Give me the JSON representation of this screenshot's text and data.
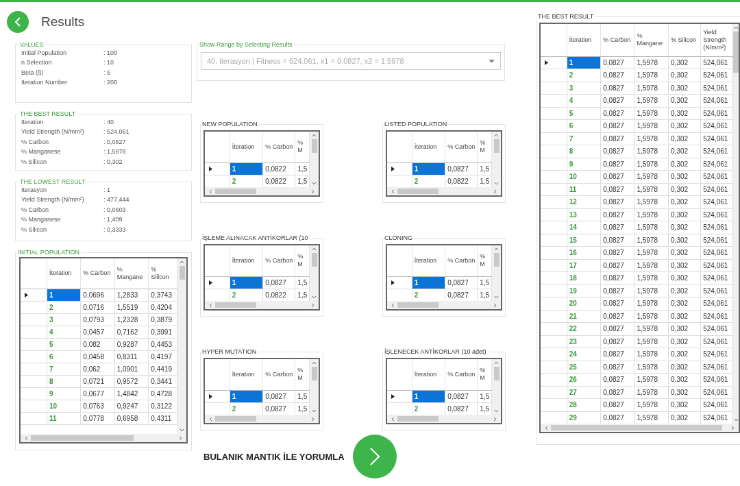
{
  "header": {
    "title": "Results"
  },
  "info_panels": [
    {
      "title": "VALUES",
      "rows": [
        {
          "label": "Initial Population",
          "value": ": 100"
        },
        {
          "label": "n Selection",
          "value": ": 10"
        },
        {
          "label": "Beta (ß)",
          "value": ": 5"
        },
        {
          "label": "Iteration Number",
          "value": ": 200"
        }
      ]
    },
    {
      "title": "THE BEST RESULT",
      "rows": [
        {
          "label": "Iteration",
          "value": ": 40"
        },
        {
          "label": "Yield Strength (N/mm²)",
          "value": ": 524,061"
        },
        {
          "label": "% Carbon",
          "value": ": 0,0827"
        },
        {
          "label": "% Manganese",
          "value": ": 1,5978"
        },
        {
          "label": "% Silicon",
          "value": ": 0,302"
        }
      ]
    },
    {
      "title": "THE LOWEST RESULT",
      "rows": [
        {
          "label": "İterasyon",
          "value": ": 1"
        },
        {
          "label": "Yield Strength (N/mm²)",
          "value": ": 477,444"
        },
        {
          "label": "% Carbon",
          "value": ": 0,0603"
        },
        {
          "label": "% Manganese",
          "value": ": 1,409"
        },
        {
          "label": "% Silicon",
          "value": ": 0,3333"
        }
      ]
    }
  ],
  "initial_population": {
    "title": "INITIAL POPULATION",
    "columns": [
      "İteration",
      "% Carbon",
      "% Mangane",
      "% Silicon"
    ],
    "rows": [
      {
        "cells": [
          "1",
          "0,0696",
          "1,2833",
          "0,3743"
        ],
        "selected": true
      },
      {
        "cells": [
          "2",
          "0,0716",
          "1,5519",
          "0,4204"
        ],
        "selected": false
      },
      {
        "cells": [
          "3",
          "0,0793",
          "1,2328",
          "0,3879"
        ],
        "selected": false
      },
      {
        "cells": [
          "4",
          "0,0457",
          "0,7162",
          "0,3991"
        ],
        "selected": false
      },
      {
        "cells": [
          "5",
          "0,082",
          "0,9287",
          "0,4453"
        ],
        "selected": false
      },
      {
        "cells": [
          "6",
          "0,0458",
          "0,8311",
          "0,4197"
        ],
        "selected": false
      },
      {
        "cells": [
          "7",
          "0,062",
          "1,0901",
          "0,4419"
        ],
        "selected": false
      },
      {
        "cells": [
          "8",
          "0,0721",
          "0,9572",
          "0,3441"
        ],
        "selected": false
      },
      {
        "cells": [
          "9",
          "0,0677",
          "1,4842",
          "0,4728"
        ],
        "selected": false
      },
      {
        "cells": [
          "10",
          "0,0763",
          "0,9247",
          "0,3122"
        ],
        "selected": false
      },
      {
        "cells": [
          "11",
          "0,0778",
          "0,6958",
          "0,4311"
        ],
        "selected": false
      }
    ]
  },
  "range": {
    "title": "Show Range by Selecting Results",
    "value": "40. iterasyon | Fitness = 524.061, x1 = 0.0827, x2 = 1.5978"
  },
  "grids": [
    {
      "title": "NEW POPULATION",
      "columns": [
        "İteration",
        "% Carbon",
        "% M"
      ],
      "rows": [
        {
          "cells": [
            "1",
            "0,0822",
            "1,5"
          ],
          "selected": true
        },
        {
          "cells": [
            "2",
            "0,0822",
            "1,5"
          ],
          "selected": false
        }
      ]
    },
    {
      "title": "LISTED POPULATION",
      "columns": [
        "İteration",
        "% Carbon",
        "% M"
      ],
      "rows": [
        {
          "cells": [
            "1",
            "0,0827",
            "1,5"
          ],
          "selected": true
        },
        {
          "cells": [
            "2",
            "0,0822",
            "1,5"
          ],
          "selected": false
        }
      ]
    },
    {
      "title": "İŞLEME ALINACAK ANTİKORLAR (10",
      "columns": [
        "İteration",
        "% Carbon",
        "% M"
      ],
      "rows": [
        {
          "cells": [
            "1",
            "0,0827",
            "1,5"
          ],
          "selected": true
        },
        {
          "cells": [
            "2",
            "0,0822",
            "1,5"
          ],
          "selected": false
        }
      ]
    },
    {
      "title": "CLONING",
      "columns": [
        "İteration",
        "% Carbon",
        "% M"
      ],
      "rows": [
        {
          "cells": [
            "1",
            "0,0827",
            "1,5"
          ],
          "selected": true
        },
        {
          "cells": [
            "2",
            "0,0827",
            "1,5"
          ],
          "selected": false
        }
      ]
    },
    {
      "title": "HYPER MUTATION",
      "columns": [
        "İteration",
        "% Carbon",
        "% M"
      ],
      "rows": [
        {
          "cells": [
            "1",
            "0,0827",
            "1,5"
          ],
          "selected": true
        },
        {
          "cells": [
            "2",
            "0,0827",
            "1,5"
          ],
          "selected": false
        }
      ]
    },
    {
      "title": "İŞLENECEK ANTİKORLAR (10 adet)",
      "columns": [
        "İteration",
        "% Carbon",
        "% M"
      ],
      "rows": [
        {
          "cells": [
            "1",
            "0,0827",
            "1,5"
          ],
          "selected": true
        },
        {
          "cells": [
            "2",
            "0,0827",
            "1,5"
          ],
          "selected": false
        }
      ]
    }
  ],
  "action": {
    "label": "BULANIK MANTIK İLE YORUMLA"
  },
  "best_table": {
    "title": "THE BEST RESULT",
    "columns": [
      "İteration",
      "% Carbon",
      "% Mangane",
      "% Silicon",
      "Yield Strength (N/mm²)"
    ],
    "rows": [
      {
        "cells": [
          "1",
          "0,0827",
          "1,5978",
          "0,302",
          "524,061"
        ],
        "selected": true
      },
      {
        "cells": [
          "2",
          "0,0827",
          "1,5978",
          "0,302",
          "524,061"
        ],
        "selected": false
      },
      {
        "cells": [
          "3",
          "0,0827",
          "1,5978",
          "0,302",
          "524,061"
        ],
        "selected": false
      },
      {
        "cells": [
          "4",
          "0,0827",
          "1,5978",
          "0,302",
          "524,061"
        ],
        "selected": false
      },
      {
        "cells": [
          "5",
          "0,0827",
          "1,5978",
          "0,302",
          "524,061"
        ],
        "selected": false
      },
      {
        "cells": [
          "6",
          "0,0827",
          "1,5978",
          "0,302",
          "524,061"
        ],
        "selected": false
      },
      {
        "cells": [
          "7",
          "0,0827",
          "1,5978",
          "0,302",
          "524,061"
        ],
        "selected": false
      },
      {
        "cells": [
          "8",
          "0,0827",
          "1,5978",
          "0,302",
          "524,061"
        ],
        "selected": false
      },
      {
        "cells": [
          "9",
          "0,0827",
          "1,5978",
          "0,302",
          "524,061"
        ],
        "selected": false
      },
      {
        "cells": [
          "10",
          "0,0827",
          "1,5978",
          "0,302",
          "524,061"
        ],
        "selected": false
      },
      {
        "cells": [
          "11",
          "0,0827",
          "1,5978",
          "0,302",
          "524,061"
        ],
        "selected": false
      },
      {
        "cells": [
          "12",
          "0,0827",
          "1,5978",
          "0,302",
          "524,061"
        ],
        "selected": false
      },
      {
        "cells": [
          "13",
          "0,0827",
          "1,5978",
          "0,302",
          "524,061"
        ],
        "selected": false
      },
      {
        "cells": [
          "14",
          "0,0827",
          "1,5978",
          "0,302",
          "524,061"
        ],
        "selected": false
      },
      {
        "cells": [
          "15",
          "0,0827",
          "1,5978",
          "0,302",
          "524,061"
        ],
        "selected": false
      },
      {
        "cells": [
          "16",
          "0,0827",
          "1,5978",
          "0,302",
          "524,061"
        ],
        "selected": false
      },
      {
        "cells": [
          "17",
          "0,0827",
          "1,5978",
          "0,302",
          "524,061"
        ],
        "selected": false
      },
      {
        "cells": [
          "18",
          "0,0827",
          "1,5978",
          "0,302",
          "524,061"
        ],
        "selected": false
      },
      {
        "cells": [
          "19",
          "0,0827",
          "1,5978",
          "0,302",
          "524,061"
        ],
        "selected": false
      },
      {
        "cells": [
          "20",
          "0,0827",
          "1,5978",
          "0,302",
          "524,061"
        ],
        "selected": false
      },
      {
        "cells": [
          "21",
          "0,0827",
          "1,5978",
          "0,302",
          "524,061"
        ],
        "selected": false
      },
      {
        "cells": [
          "22",
          "0,0827",
          "1,5978",
          "0,302",
          "524,061"
        ],
        "selected": false
      },
      {
        "cells": [
          "23",
          "0,0827",
          "1,5978",
          "0,302",
          "524,061"
        ],
        "selected": false
      },
      {
        "cells": [
          "24",
          "0,0827",
          "1,5978",
          "0,302",
          "524,061"
        ],
        "selected": false
      },
      {
        "cells": [
          "25",
          "0,0827",
          "1,5978",
          "0,302",
          "524,061"
        ],
        "selected": false
      },
      {
        "cells": [
          "26",
          "0,0827",
          "1,5978",
          "0,302",
          "524,061"
        ],
        "selected": false
      },
      {
        "cells": [
          "27",
          "0,0827",
          "1,5978",
          "0,302",
          "524,061"
        ],
        "selected": false
      },
      {
        "cells": [
          "28",
          "0,0827",
          "1,5978",
          "0,302",
          "524,061"
        ],
        "selected": false
      },
      {
        "cells": [
          "29",
          "0,0827",
          "1,5978",
          "0,302",
          "524,061"
        ],
        "selected": false
      }
    ]
  }
}
